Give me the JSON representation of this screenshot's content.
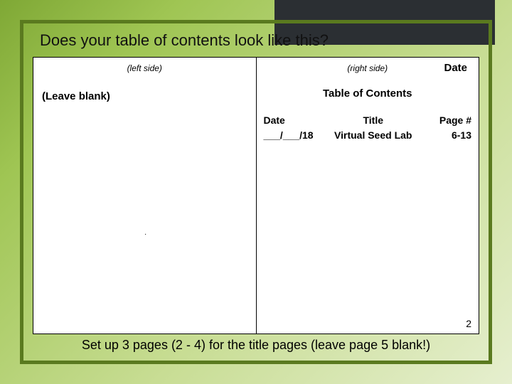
{
  "title": "Does your table of contents look like this?",
  "left": {
    "label": "(left side)",
    "leave_blank": "(Leave blank)"
  },
  "right": {
    "label": "(right side)",
    "date_top": "Date",
    "toc_title": "Table of Contents",
    "headers": {
      "date": "Date",
      "title": "Title",
      "page": "Page #"
    },
    "rows": [
      {
        "date": "___/___/18",
        "title": "Virtual Seed Lab",
        "page": "6-13"
      }
    ],
    "page_number": "2"
  },
  "footer": "Set up 3 pages (2 - 4) for the title pages (leave page 5 blank!)"
}
